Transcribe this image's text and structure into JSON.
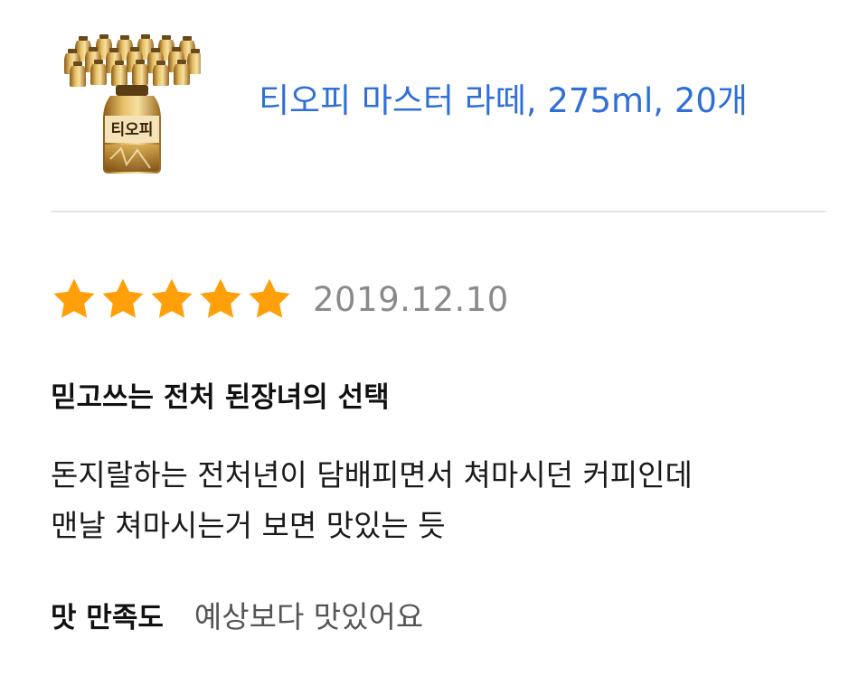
{
  "product": {
    "name": "티오피 마스터 라떼, 275ml, 20개",
    "image_icon": "bottle-pack-icon",
    "name_color": "#2f6fd6"
  },
  "review": {
    "rating": 5,
    "rating_max": 5,
    "star_color": "#ff9f0a",
    "date": "2019.12.10",
    "title": "믿고쓰는 전처 된장녀의 선택",
    "body_lines": [
      "돈지랄하는 전처년이 담배피면서 쳐마시던 커피인데",
      "맨날 쳐마시는거 보면 맛있는 듯"
    ],
    "survey": {
      "label": "맛 만족도",
      "answer": "예상보다 맛있어요"
    }
  }
}
